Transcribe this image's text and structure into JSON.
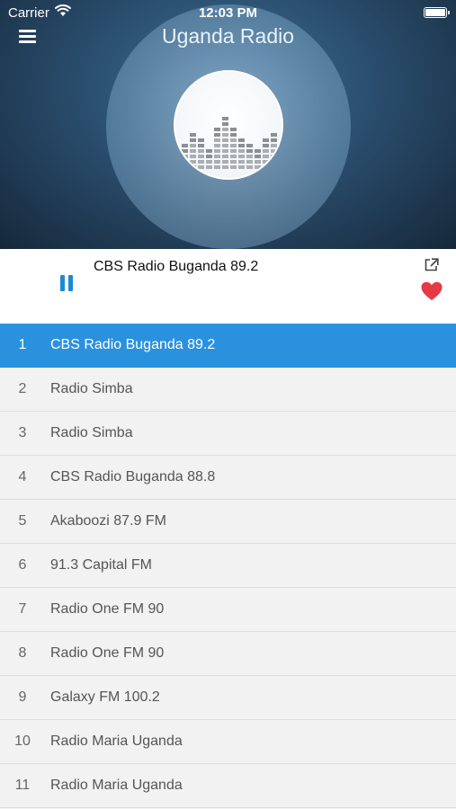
{
  "status_bar": {
    "carrier": "Carrier",
    "time": "12:03 PM"
  },
  "header": {
    "title": "Uganda Radio",
    "background_color": "#2a4e6e"
  },
  "now_playing": {
    "station": "CBS Radio Buganda 89.2",
    "state": "playing",
    "favorited": true,
    "accent_color": "#1e88d6",
    "heart_color": "#e63946"
  },
  "stations": [
    {
      "num": "1",
      "name": "CBS Radio Buganda 89.2",
      "active": true
    },
    {
      "num": "2",
      "name": "Radio Simba"
    },
    {
      "num": "3",
      "name": "Radio Simba"
    },
    {
      "num": "4",
      "name": "CBS Radio Buganda 88.8"
    },
    {
      "num": "5",
      "name": "Akaboozi 87.9 FM"
    },
    {
      "num": "6",
      "name": "91.3 Capital FM"
    },
    {
      "num": "7",
      "name": "Radio One FM 90"
    },
    {
      "num": "8",
      "name": "Radio One FM 90"
    },
    {
      "num": "9",
      "name": "Galaxy FM 100.2"
    },
    {
      "num": "10",
      "name": "Radio Maria Uganda"
    },
    {
      "num": "11",
      "name": "Radio Maria Uganda"
    }
  ],
  "icons": {
    "menu": "menu-icon",
    "wifi": "wifi-icon",
    "battery": "battery-icon",
    "visualizer": "equalizer-icon",
    "pause": "pause-icon",
    "share": "share-icon",
    "favorite": "heart-icon"
  },
  "active_row_color": "#2a91df"
}
